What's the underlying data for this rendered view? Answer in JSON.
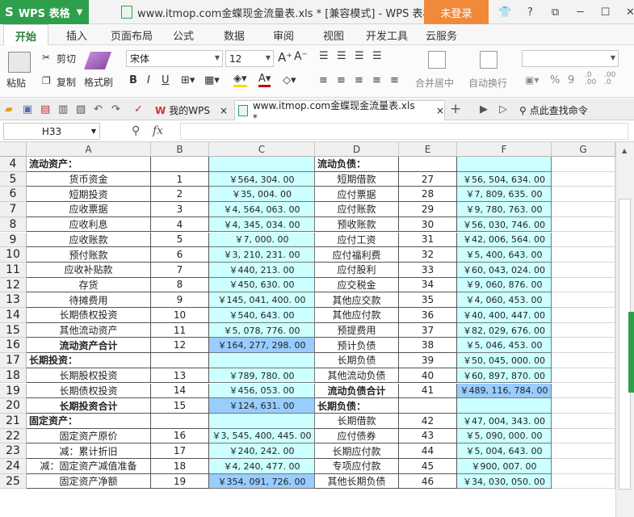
{
  "titlebar": {
    "app_name": "WPS 表格",
    "doc_title": "www.itmop.com金蝶现金流量表.xls * [兼容模式] - WPS 表格",
    "login_label": "未登录",
    "icons": [
      "shirt-icon",
      "help-icon",
      "restore-icon",
      "minimize-icon",
      "maximize-icon",
      "close-icon"
    ]
  },
  "menu": {
    "tabs": [
      "开始",
      "插入",
      "页面布局",
      "公式",
      "数据",
      "审阅",
      "视图",
      "开发工具",
      "云服务"
    ]
  },
  "ribbon": {
    "paste": "粘贴",
    "cut": "剪切",
    "copy": "复制",
    "format_painter": "格式刷",
    "font_name": "宋体",
    "font_size": "12",
    "merge_center": "合并居中",
    "wrap_text": "自动换行",
    "percent": "%",
    "comma": "9"
  },
  "tabbar": {
    "tabs": [
      "我的WPS",
      "www.itmop.com金蝶现金流量表.xls *"
    ],
    "search_label": "点此查找命令",
    "add_label": "+"
  },
  "formula": {
    "name_box": "H33",
    "fx": "fx",
    "value": ""
  },
  "sheet": {
    "columns": [
      "A",
      "B",
      "C",
      "D",
      "E",
      "F",
      "G"
    ],
    "rows": [
      {
        "n": "4",
        "a": "流动资产：",
        "b": "",
        "c": "",
        "d": "流动负债：",
        "e": "",
        "f": "",
        "hdr": true
      },
      {
        "n": "5",
        "a": "货币资金",
        "b": "1",
        "c": "￥564, 304. 00",
        "d": "短期借款",
        "e": "27",
        "f": "￥56, 504, 634. 00"
      },
      {
        "n": "6",
        "a": "短期投资",
        "b": "2",
        "c": "￥35, 004. 00",
        "d": "应付票据",
        "e": "28",
        "f": "￥7, 809, 635. 00"
      },
      {
        "n": "7",
        "a": "应收票据",
        "b": "3",
        "c": "￥4, 564, 063. 00",
        "d": "应付账款",
        "e": "29",
        "f": "￥9, 780, 763. 00"
      },
      {
        "n": "8",
        "a": "应收利息",
        "b": "4",
        "c": "￥4, 345, 034. 00",
        "d": "预收账款",
        "e": "30",
        "f": "￥56, 030, 746. 00"
      },
      {
        "n": "9",
        "a": "应收账款",
        "b": "5",
        "c": "￥7, 000. 00",
        "d": "应付工资",
        "e": "31",
        "f": "￥42, 006, 564. 00"
      },
      {
        "n": "10",
        "a": "预付账款",
        "b": "6",
        "c": "￥3, 210, 231. 00",
        "d": "应付福利费",
        "e": "32",
        "f": "￥5, 400, 643. 00"
      },
      {
        "n": "11",
        "a": "应收补贴款",
        "b": "7",
        "c": "￥440, 213. 00",
        "d": "应付股利",
        "e": "33",
        "f": "￥60, 043, 024. 00"
      },
      {
        "n": "12",
        "a": "存货",
        "b": "8",
        "c": "￥450, 630. 00",
        "d": "应交税金",
        "e": "34",
        "f": "￥9, 060, 876. 00"
      },
      {
        "n": "13",
        "a": "待摊费用",
        "b": "9",
        "c": "￥145, 041, 400. 00",
        "d": "其他应交款",
        "e": "35",
        "f": "￥4, 060, 453. 00"
      },
      {
        "n": "14",
        "a": "长期债权投资",
        "b": "10",
        "c": "￥540, 643. 00",
        "d": "其他应付款",
        "e": "36",
        "f": "￥40, 400, 447. 00"
      },
      {
        "n": "15",
        "a": "其他流动资产",
        "b": "11",
        "c": "￥5, 078, 776. 00",
        "d": "预提费用",
        "e": "37",
        "f": "￥82, 029, 676. 00"
      },
      {
        "n": "16",
        "a": "流动资产合计",
        "b": "12",
        "c": "￥164, 277, 298. 00",
        "d": "预计负债",
        "e": "38",
        "f": "￥5, 046, 453. 00",
        "bold_a": true,
        "hl_c": true
      },
      {
        "n": "17",
        "a": "长期投资：",
        "b": "",
        "c": "",
        "d": "长期负债",
        "e": "39",
        "f": "￥50, 045, 000. 00",
        "hdr_a": true
      },
      {
        "n": "18",
        "a": "长期股权投资",
        "b": "13",
        "c": "￥789, 780. 00",
        "d": "其他流动负债",
        "e": "40",
        "f": "￥60, 897, 870. 00"
      },
      {
        "n": "19",
        "a": "长期债权投资",
        "b": "14",
        "c": "￥456, 053. 00",
        "d": "流动负债合计",
        "e": "41",
        "f": "￥489, 116, 784. 00",
        "bold_d": true,
        "hl_f": true
      },
      {
        "n": "20",
        "a": "长期投资合计",
        "b": "15",
        "c": "￥124, 631. 00",
        "d": "长期负债：",
        "e": "",
        "f": "",
        "bold_a": true,
        "hl_c": true,
        "hdr_d": true
      },
      {
        "n": "21",
        "a": "固定资产：",
        "b": "",
        "c": "",
        "d": "长期借款",
        "e": "42",
        "f": "￥47, 004, 343. 00",
        "hdr_a": true
      },
      {
        "n": "22",
        "a": "固定资产原价",
        "b": "16",
        "c": "￥3, 545, 400, 445. 00",
        "d": "应付债券",
        "e": "43",
        "f": "￥5, 090, 000. 00"
      },
      {
        "n": "23",
        "a": "减：累计折旧",
        "b": "17",
        "c": "￥240, 242. 00",
        "d": "长期应付款",
        "e": "44",
        "f": "￥5, 004, 643. 00"
      },
      {
        "n": "24",
        "a": "减：固定资产减值准备",
        "b": "18",
        "c": "￥4, 240, 477. 00",
        "d": "专项应付款",
        "e": "45",
        "f": "￥900, 007. 00"
      },
      {
        "n": "25",
        "a": "固定资产净额",
        "b": "19",
        "c": "￥354, 091, 726. 00",
        "d": "其他长期负债",
        "e": "46",
        "f": "￥34, 030, 050. 00",
        "hl_c": true
      }
    ]
  },
  "colors": {
    "brand_green": "#2e9f4d",
    "login_orange": "#f08a3a",
    "cell_cyan": "#ccffff",
    "cell_blue": "#99ccff"
  }
}
